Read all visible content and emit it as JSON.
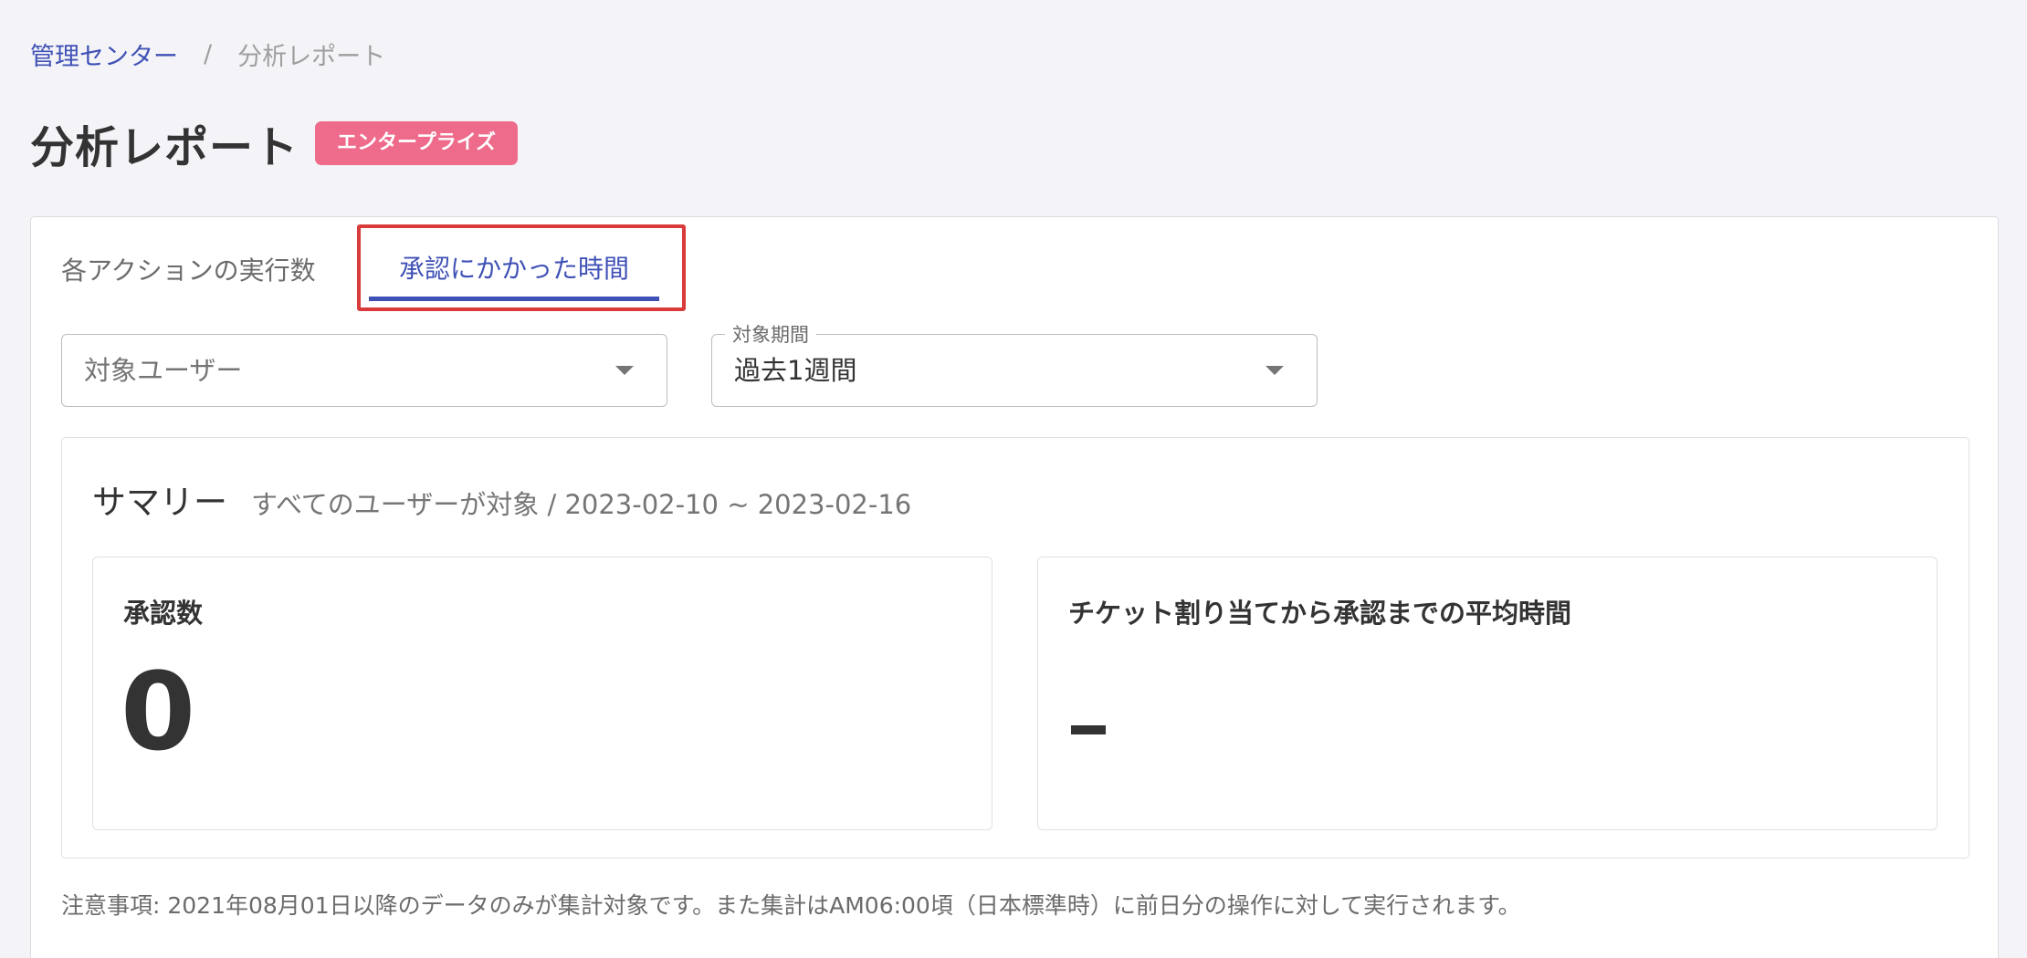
{
  "breadcrumb": {
    "root": "管理センター",
    "separator": "/",
    "current": "分析レポート"
  },
  "page": {
    "title": "分析レポート",
    "badge": "エンタープライズ"
  },
  "tabs": [
    {
      "label": "各アクションの実行数",
      "active": false
    },
    {
      "label": "承認にかかった時間",
      "active": true
    }
  ],
  "filters": {
    "user": {
      "placeholder": "対象ユーザー"
    },
    "period": {
      "label": "対象期間",
      "value": "過去1週間"
    }
  },
  "summary": {
    "title": "サマリー",
    "subtitle": "すべてのユーザーが対象 / 2023-02-10 ~ 2023-02-16",
    "cards": [
      {
        "label": "承認数",
        "value": "0"
      },
      {
        "label": "チケット割り当てから承認までの平均時間",
        "value": "-"
      }
    ]
  },
  "note": "注意事項: 2021年08月01日以降のデータのみが集計対象です。また集計はAM06:00頃（日本標準時）に前日分の操作に対して実行されます。",
  "colors": {
    "accent": "#3f51b5",
    "badge": "#ee6b8b",
    "highlight": "#d93a3a",
    "background": "#f4f4f8"
  }
}
